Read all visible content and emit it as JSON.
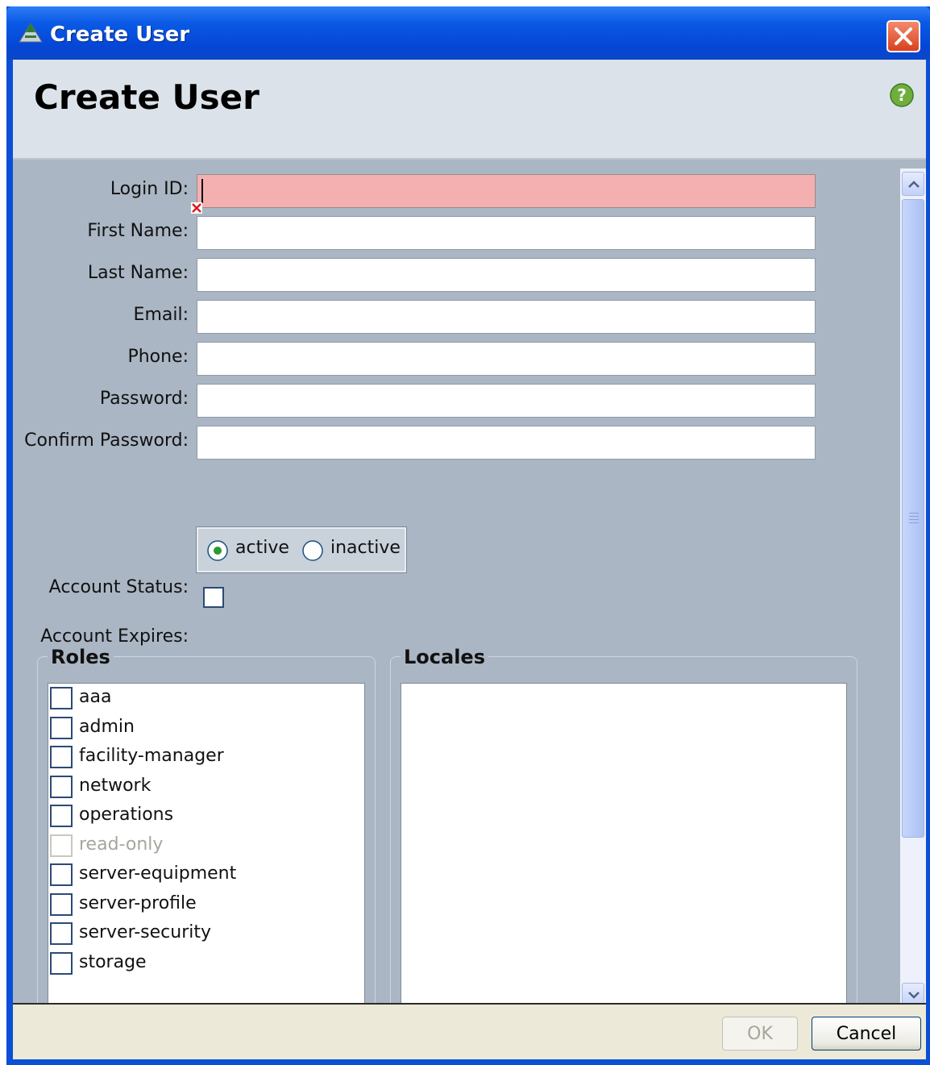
{
  "window": {
    "title": "Create User"
  },
  "header": {
    "heading": "Create User"
  },
  "form": {
    "login_id": {
      "label": "Login ID:",
      "value": ""
    },
    "first_name": {
      "label": "First Name:",
      "value": ""
    },
    "last_name": {
      "label": "Last Name:",
      "value": ""
    },
    "email": {
      "label": "Email:",
      "value": ""
    },
    "phone": {
      "label": "Phone:",
      "value": ""
    },
    "password": {
      "label": "Password:",
      "value": ""
    },
    "confirm_password": {
      "label": "Confirm Password:",
      "value": ""
    },
    "account_status": {
      "label": "Account Status:",
      "options": [
        {
          "label": "active",
          "selected": true
        },
        {
          "label": "inactive",
          "selected": false
        }
      ]
    },
    "account_expires": {
      "label": "Account Expires:",
      "checked": false
    }
  },
  "roles": {
    "title": "Roles",
    "items": [
      {
        "label": "aaa",
        "disabled": false
      },
      {
        "label": "admin",
        "disabled": false
      },
      {
        "label": "facility-manager",
        "disabled": false
      },
      {
        "label": "network",
        "disabled": false
      },
      {
        "label": "operations",
        "disabled": false
      },
      {
        "label": "read-only",
        "disabled": true
      },
      {
        "label": "server-equipment",
        "disabled": false
      },
      {
        "label": "server-profile",
        "disabled": false
      },
      {
        "label": "server-security",
        "disabled": false
      },
      {
        "label": "storage",
        "disabled": false
      }
    ]
  },
  "locales": {
    "title": "Locales",
    "items": []
  },
  "footer": {
    "ok_label": "OK",
    "cancel_label": "Cancel"
  },
  "colors": {
    "error_field": "#f4b0b0",
    "panel": "#aab6c3",
    "titlebar": "#0a5ae6"
  }
}
